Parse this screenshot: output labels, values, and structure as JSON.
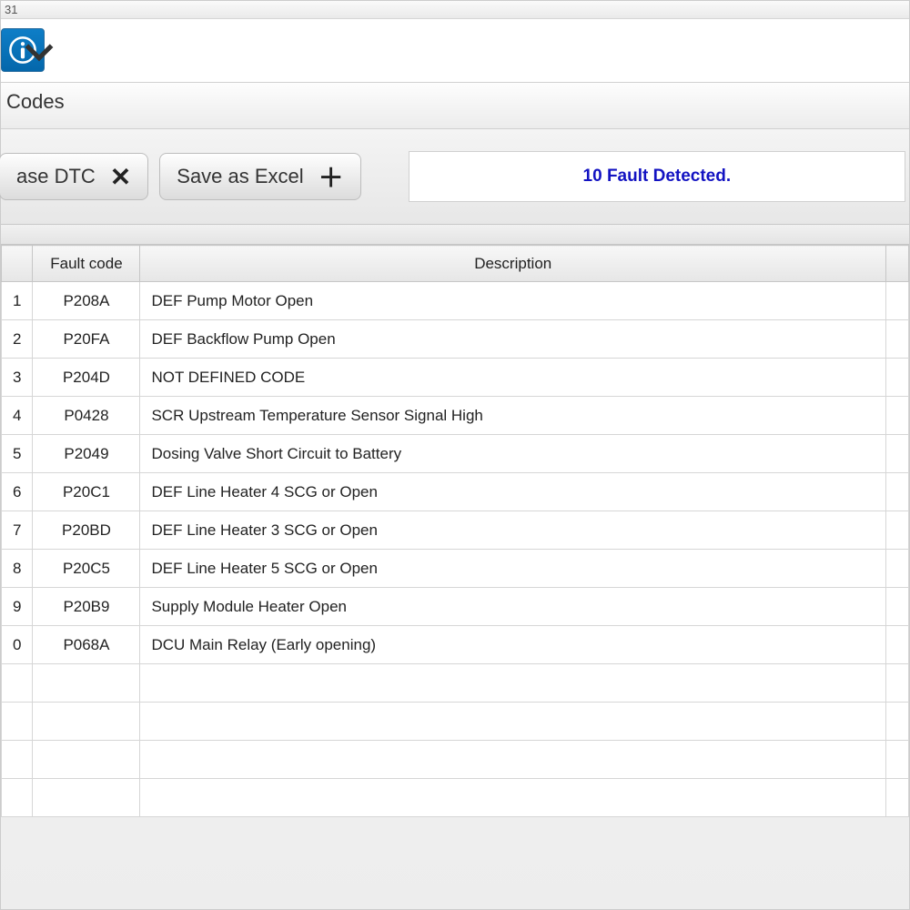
{
  "title_fragment": "31",
  "section_label_fragment": "Codes",
  "toolbar": {
    "erase_label": "ase DTC",
    "save_label": "Save as Excel"
  },
  "status_text": "10 Fault Detected.",
  "headers": {
    "idx": "",
    "code": "Fault code",
    "desc": "Description",
    "extra": ""
  },
  "rows": [
    {
      "idx": "1",
      "code": "P208A",
      "desc": "DEF Pump Motor Open"
    },
    {
      "idx": "2",
      "code": "P20FA",
      "desc": "DEF Backflow Pump Open"
    },
    {
      "idx": "3",
      "code": "P204D",
      "desc": "NOT DEFINED CODE"
    },
    {
      "idx": "4",
      "code": "P0428",
      "desc": "SCR Upstream Temperature Sensor Signal High"
    },
    {
      "idx": "5",
      "code": "P2049",
      "desc": "Dosing Valve Short Circuit to Battery"
    },
    {
      "idx": "6",
      "code": "P20C1",
      "desc": "DEF Line Heater 4 SCG or Open"
    },
    {
      "idx": "7",
      "code": "P20BD",
      "desc": "DEF Line Heater 3 SCG or Open"
    },
    {
      "idx": "8",
      "code": "P20C5",
      "desc": "DEF Line Heater 5 SCG or Open"
    },
    {
      "idx": "9",
      "code": "P20B9",
      "desc": "Supply Module Heater Open"
    },
    {
      "idx": "0",
      "code": "P068A",
      "desc": "DCU Main Relay (Early opening)"
    }
  ],
  "empty_rows": 4
}
